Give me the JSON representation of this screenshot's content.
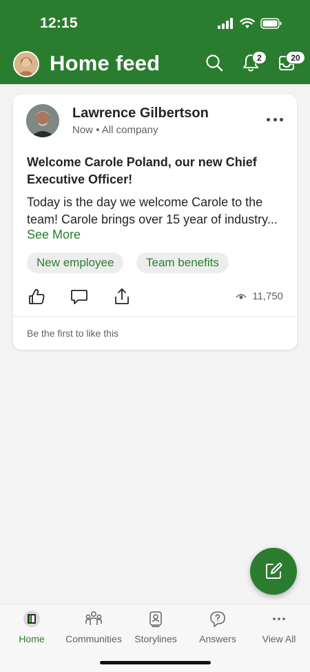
{
  "status_bar": {
    "time": "12:15"
  },
  "header": {
    "title": "Home feed",
    "notifications_count": "2",
    "inbox_count": "20"
  },
  "post": {
    "author": "Lawrence Gilbertson",
    "time": "Now",
    "audience": "All company",
    "title": "Welcome Carole Poland, our new Chief Executive Officer!",
    "body": "Today is the day we welcome Carole to the team! Carole brings over 15 year of industry...",
    "see_more": "See More",
    "tags": [
      "New employee",
      "Team benefits"
    ],
    "views": "11,750",
    "likes_text": "Be the first to like this"
  },
  "bottom_nav": {
    "items": [
      {
        "label": "Home",
        "icon": "home-icon",
        "active": true
      },
      {
        "label": "Communities",
        "icon": "communities-icon"
      },
      {
        "label": "Storylines",
        "icon": "storylines-icon"
      },
      {
        "label": "Answers",
        "icon": "answers-icon"
      },
      {
        "label": "View All",
        "icon": "more-icon"
      }
    ]
  },
  "colors": {
    "brand": "#2a7d2e",
    "background": "#f3f3f3",
    "card": "#ffffff"
  }
}
